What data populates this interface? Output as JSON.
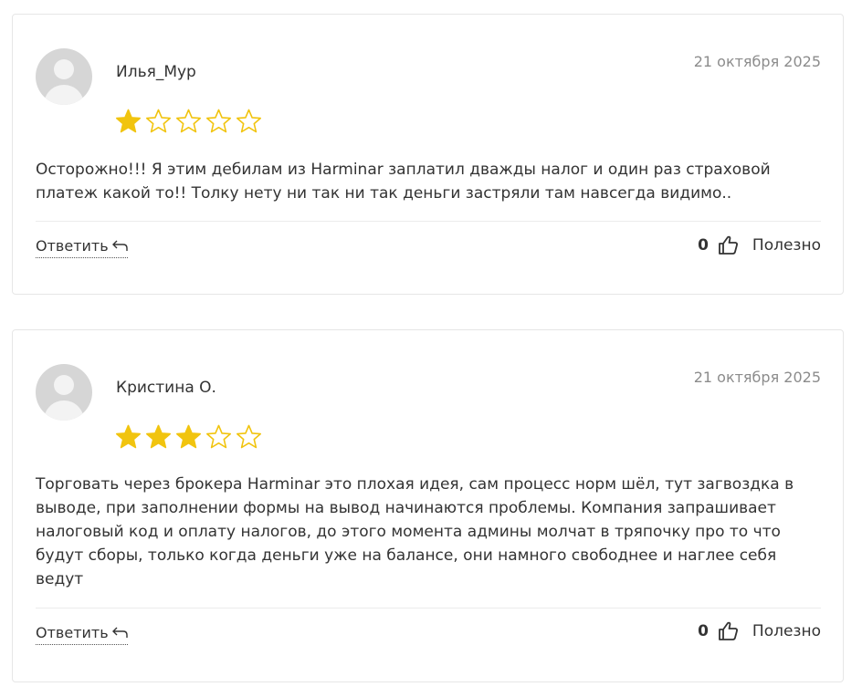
{
  "colors": {
    "star_filled": "#F1C40F",
    "star_empty_stroke": "#F1C40F",
    "date": "#8c8c8c",
    "border": "#e6e6e6"
  },
  "reviews": [
    {
      "author": "Илья_Мур",
      "date": "21 октября 2025",
      "rating": 1,
      "max_rating": 5,
      "text": "Осторожно!!! Я этим дебилам из Harminar заплатил дважды налог и один раз страховой платеж какой то!! Толку нету ни так ни так деньги застряли там навсегда видимо..",
      "reply_label": "Ответить",
      "helpful_count": "0",
      "helpful_label": "Полезно"
    },
    {
      "author": "Кристина О.",
      "date": "21 октября 2025",
      "rating": 3,
      "max_rating": 5,
      "text": "Торговать через брокера Harminar это плохая идея, сам процесс норм шёл, тут загвоздка в выводе, при заполнении формы на вывод начинаются проблемы. Компания запрашивает налоговый код и оплату налогов, до этого момента админы молчат в тряпочку про то что будут сборы, только когда деньги уже на балансе, они намного свободнее и наглее себя ведут",
      "reply_label": "Ответить",
      "helpful_count": "0",
      "helpful_label": "Полезно"
    }
  ]
}
